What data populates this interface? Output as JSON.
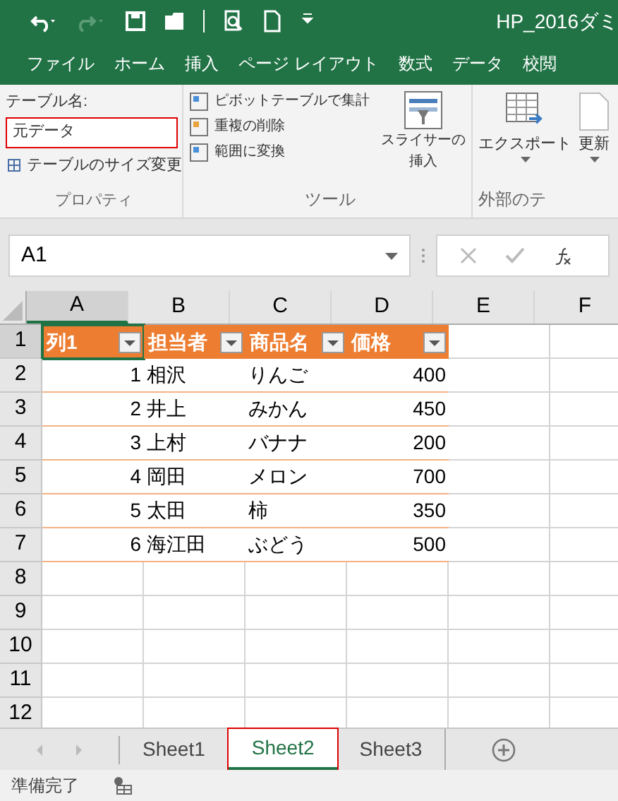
{
  "window": {
    "title": "HP_2016ダミ"
  },
  "ribbon_tabs": [
    "ファイル",
    "ホーム",
    "挿入",
    "ページ レイアウト",
    "数式",
    "データ",
    "校閲"
  ],
  "ribbon": {
    "properties": {
      "name_label": "テーブル名:",
      "name_value": "元データ",
      "resize": "テーブルのサイズ変更",
      "group": "プロパティ"
    },
    "tools": {
      "buttons": [
        "ピボットテーブルで集計",
        "重複の削除",
        "範囲に変換"
      ],
      "slicer": [
        "スライサーの",
        "挿入"
      ],
      "group": "ツール"
    },
    "external": {
      "export": "エクスポート",
      "refresh": "更新",
      "group": "外部のテ"
    }
  },
  "name_box": {
    "value": "A1"
  },
  "columns": [
    "A",
    "B",
    "C",
    "D",
    "E",
    "F"
  ],
  "row_numbers": [
    "1",
    "2",
    "3",
    "4",
    "5",
    "6",
    "7",
    "8",
    "9",
    "10",
    "11",
    "12"
  ],
  "table": {
    "headers": [
      "列1",
      "担当者",
      "商品名",
      "価格"
    ],
    "rows": [
      [
        "1",
        "相沢",
        "りんご",
        "400"
      ],
      [
        "2",
        "井上",
        "みかん",
        "450"
      ],
      [
        "3",
        "上村",
        "バナナ",
        "200"
      ],
      [
        "4",
        "岡田",
        "メロン",
        "700"
      ],
      [
        "5",
        "太田",
        "柿",
        "350"
      ],
      [
        "6",
        "海江田",
        "ぶどう",
        "500"
      ]
    ]
  },
  "sheet_tabs": [
    {
      "label": "Sheet1",
      "selected": false
    },
    {
      "label": "Sheet2",
      "selected": true
    },
    {
      "label": "Sheet3",
      "selected": false
    }
  ],
  "status_bar": {
    "text": "準備完了"
  }
}
